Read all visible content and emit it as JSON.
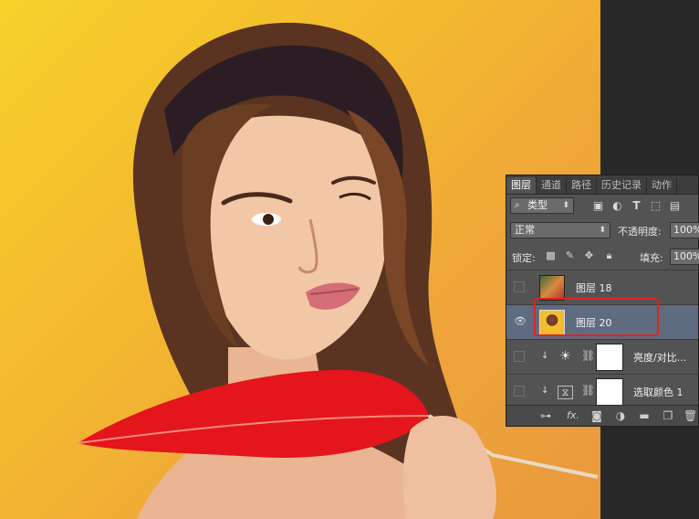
{
  "panel": {
    "tabs": [
      {
        "label": "图层",
        "active": true
      },
      {
        "label": "通道",
        "active": false
      },
      {
        "label": "路径",
        "active": false
      },
      {
        "label": "历史记录",
        "active": false
      },
      {
        "label": "动作",
        "active": false
      }
    ],
    "filter": {
      "label": "类型",
      "icon": "search-icon"
    },
    "blend_mode": "正常",
    "opacity_label": "不透明度:",
    "opacity_value": "100%",
    "lock_label": "锁定:",
    "fill_label": "填充:",
    "fill_value": "100%",
    "layers": [
      {
        "name": "图层 18",
        "visible": false,
        "selected": false
      },
      {
        "name": "图层 20",
        "visible": true,
        "selected": true
      },
      {
        "name": "亮度/对比...",
        "visible": false,
        "selected": false,
        "adjustment": "brightness-contrast",
        "clipped": true
      },
      {
        "name": "选取颜色 1",
        "visible": false,
        "selected": false,
        "adjustment": "selective-color",
        "clipped": true
      }
    ],
    "bottom_icons": [
      "link-icon",
      "fx-icon",
      "add-mask-icon",
      "adjustment-layer-icon",
      "folder-icon",
      "new-layer-icon",
      "trash-icon"
    ],
    "fx_label": "fx."
  },
  "colors": {
    "highlight": "#e0231e",
    "selected_row": "#5e6b80",
    "panel_bg": "#535353",
    "canvas_bg": "#f3b82f"
  }
}
